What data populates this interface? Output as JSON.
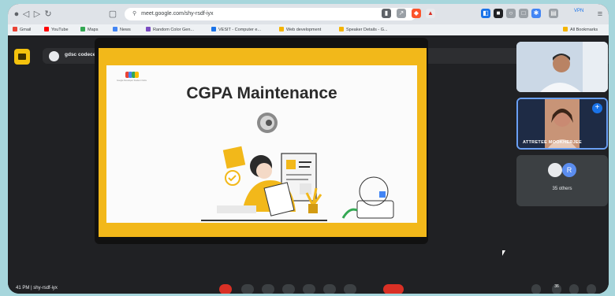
{
  "browser": {
    "url": "meet.google.com/shy-rsdf-iyx",
    "vpn_label": "VPN",
    "bookmarks": [
      {
        "label": "Gmail",
        "color": "#ea4335"
      },
      {
        "label": "YouTube",
        "color": "#ff0000"
      },
      {
        "label": "Maps",
        "color": "#34a853"
      },
      {
        "label": "News",
        "color": "#4285f4"
      },
      {
        "label": "Random Color Gen...",
        "color": "#7a4cc2"
      },
      {
        "label": "VESIT - Computer e...",
        "color": "#1a73e8"
      },
      {
        "label": "Web development",
        "color": "#f4b400"
      },
      {
        "label": "Speaker Details - G...",
        "color": "#f4b400"
      }
    ],
    "all_bookmarks": "All Bookmarks"
  },
  "meet": {
    "presenting_label": "gdsc codecell CMPN (Presenting)",
    "slide": {
      "org_name": "Google Developer Student Clubs",
      "title": "CGPA Maintenance",
      "accent": "#f2b81a"
    },
    "participants": [
      {
        "name": "",
        "tile": "camera"
      },
      {
        "name": "ATTRETEE MOOKHERJEE",
        "tile": "camera",
        "pinned": true
      },
      {
        "name": "35 others",
        "tile": "others",
        "avatar_letter": "R"
      }
    ],
    "bottom": {
      "time_and_code": "41 PM | shy-rsdf-iyx",
      "badge": "36"
    }
  }
}
